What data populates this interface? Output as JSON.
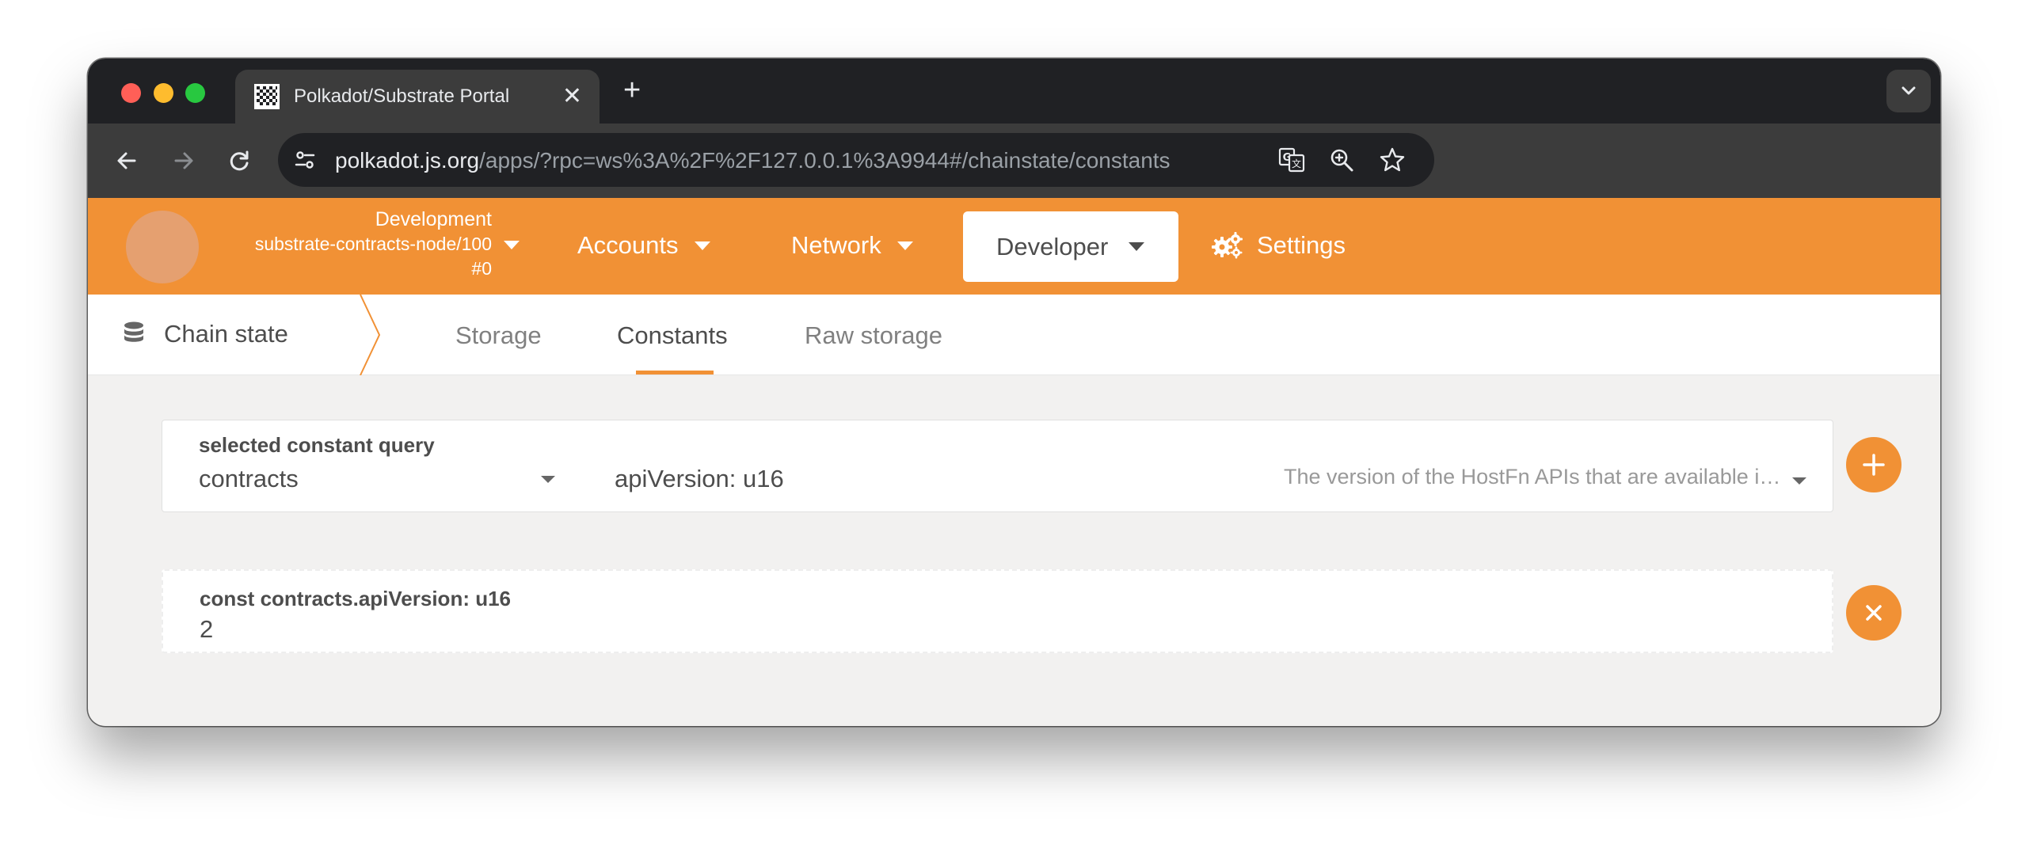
{
  "browser": {
    "tab_title": "Polkadot/Substrate Portal",
    "new_tab_label": "+",
    "url_host": "polkadot.js.org",
    "url_path": "/apps/?rpc=ws%3A%2F%2F127.0.0.1%3A9944#/chainstate/constants"
  },
  "header": {
    "chain_name": "Development",
    "node_name": "substrate-contracts-node/100",
    "block": "#0",
    "menu": {
      "accounts": "Accounts",
      "network": "Network",
      "developer": "Developer",
      "settings": "Settings"
    },
    "accent_color": "#f19135"
  },
  "subnav": {
    "section": "Chain state",
    "tabs": [
      "Storage",
      "Constants",
      "Raw storage"
    ],
    "active_tab": "Constants"
  },
  "query": {
    "label": "selected constant query",
    "section": "contracts",
    "method": "apiVersion: u16",
    "doc": "The version of the HostFn APIs that are available in the runtime."
  },
  "result": {
    "label": "const contracts.apiVersion: u16",
    "value": "2"
  }
}
